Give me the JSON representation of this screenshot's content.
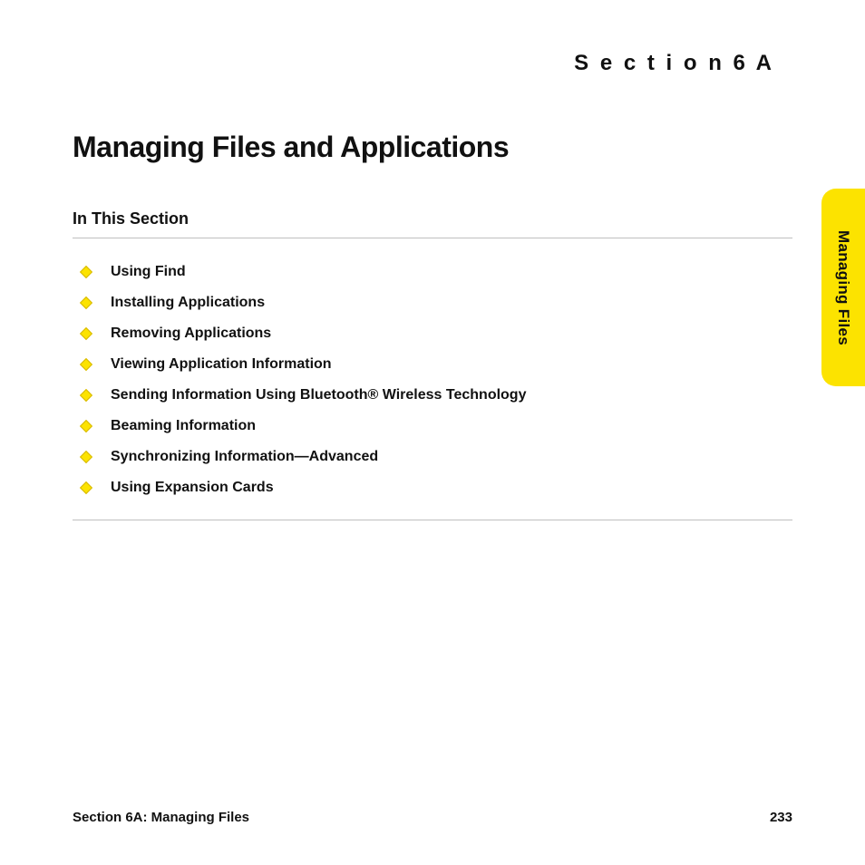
{
  "header": {
    "section_label": "S e c t i o n  6 A",
    "title": "Managing Files and Applications",
    "subheading": "In This Section"
  },
  "toc": [
    {
      "label": "Using Find"
    },
    {
      "label": "Installing Applications"
    },
    {
      "label": "Removing Applications"
    },
    {
      "label": "Viewing Application Information"
    },
    {
      "label": "Sending Information Using Bluetooth® Wireless Technology"
    },
    {
      "label": "Beaming Information"
    },
    {
      "label": "Synchronizing Information—Advanced"
    },
    {
      "label": "Using Expansion Cards"
    }
  ],
  "side_tab": {
    "label": "Managing Files"
  },
  "footer": {
    "left": "Section 6A: Managing Files",
    "page_number": "233"
  }
}
